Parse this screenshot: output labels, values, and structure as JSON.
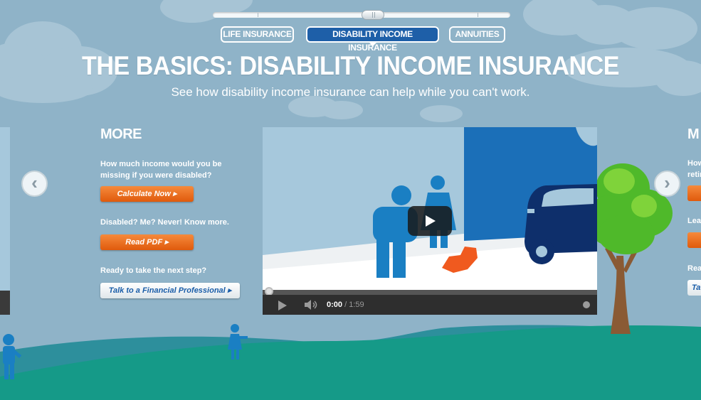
{
  "nav": {
    "tabs": [
      {
        "label": "LIFE INSURANCE",
        "active": false
      },
      {
        "label": "DISABILITY INCOME INSURANCE",
        "active": true
      },
      {
        "label": "ANNUITIES",
        "active": false
      }
    ]
  },
  "header": {
    "title": "THE BASICS: DISABILITY INCOME INSURANCE",
    "subtitle": "See how disability income insurance can help while you can't work."
  },
  "panel": {
    "heading": "MORE",
    "q1": "How much income would you be missing if you were disabled?",
    "calc_button": "Calculate Now ▸",
    "q2": "Disabled? Me? Never! Know more.",
    "pdf_button": "Read PDF ▸",
    "q3": "Ready to take the next step?",
    "advisor_button": "Talk to a Financial Professional ▸"
  },
  "video": {
    "current_time": "0:00",
    "duration": "/ 1:59"
  },
  "arrows": {
    "prev": "‹",
    "next": "›"
  },
  "ghost_right": {
    "heading": "M",
    "line1": "How",
    "line2": "retir",
    "line3": "Lea",
    "line4": "Rea",
    "btn_text": "Ta"
  },
  "colors": {
    "sky": "#8fb3c8",
    "hill": "#169a8a",
    "accent_blue": "#1e5fa8",
    "orange": "#e8661c"
  }
}
